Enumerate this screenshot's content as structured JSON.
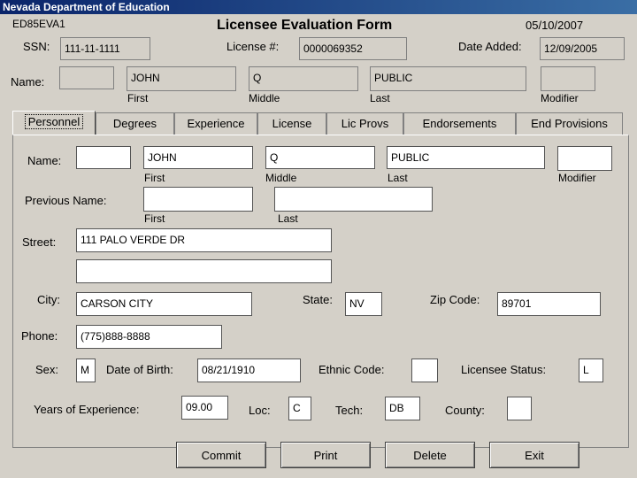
{
  "window": {
    "title": "Nevada Department of Education"
  },
  "header": {
    "form_code": "ED85EVA1",
    "heading": "Licensee Evaluation Form",
    "date": "05/10/2007",
    "ssn_label": "SSN:",
    "ssn": "111-11-1111",
    "license_label": "License #:",
    "license": "0000069352",
    "date_added_label": "Date Added:",
    "date_added": "12/09/2005",
    "name_label": "Name:",
    "name_prefix": "",
    "first": "JOHN",
    "middle": "Q",
    "last": "PUBLIC",
    "modifier": "",
    "first_caption": "First",
    "middle_caption": "Middle",
    "last_caption": "Last",
    "modifier_caption": "Modifier"
  },
  "tabs": [
    {
      "label": "Personnel"
    },
    {
      "label": "Degrees"
    },
    {
      "label": "Experience"
    },
    {
      "label": "License"
    },
    {
      "label": "Lic Provs"
    },
    {
      "label": "Endorsements"
    },
    {
      "label": "End Provisions"
    }
  ],
  "personnel": {
    "name_label": "Name:",
    "name_prefix": "",
    "first": "JOHN",
    "middle": "Q",
    "last": "PUBLIC",
    "modifier": "",
    "first_caption": "First",
    "middle_caption": "Middle",
    "last_caption": "Last",
    "modifier_caption": "Modifier",
    "prev_name_label": "Previous Name:",
    "prev_first": "",
    "prev_last": "",
    "prev_first_caption": "First",
    "prev_last_caption": "Last",
    "street_label": "Street:",
    "street1": "111 PALO VERDE DR",
    "street2": "",
    "city_label": "City:",
    "city": "CARSON CITY",
    "state_label": "State:",
    "state": "NV",
    "zip_label": "Zip Code:",
    "zip": "89701",
    "phone_label": "Phone:",
    "phone": "(775)888-8888",
    "sex_label": "Sex:",
    "sex": "M",
    "dob_label": "Date of Birth:",
    "dob": "08/21/1910",
    "ethnic_label": "Ethnic Code:",
    "ethnic": "",
    "status_label": "Licensee Status:",
    "status": "L",
    "years_label": "Years of Experience:",
    "years": "09.00",
    "loc_label": "Loc:",
    "loc": "C",
    "tech_label": "Tech:",
    "tech": "DB",
    "county_label": "County:",
    "county": ""
  },
  "buttons": {
    "commit": "Commit",
    "print": "Print",
    "delete": "Delete",
    "exit": "Exit"
  }
}
